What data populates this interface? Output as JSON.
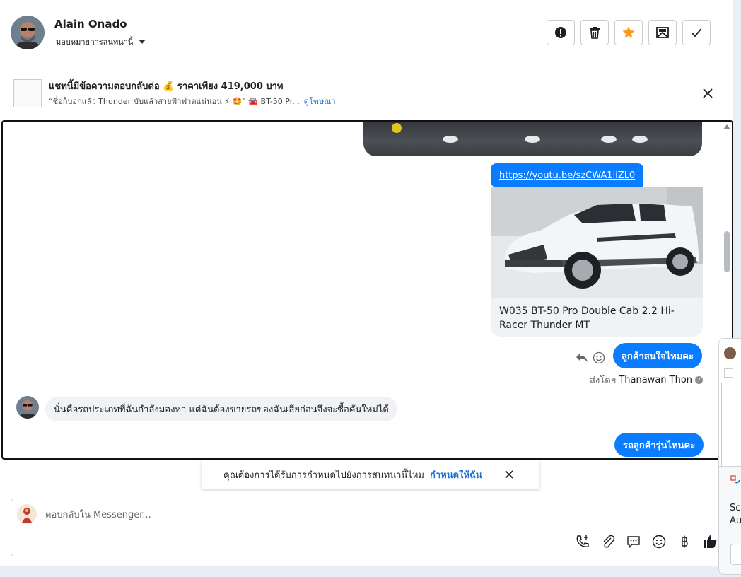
{
  "header": {
    "name": "Alain Onado",
    "assign_label": "มอบหมายการสนทนานี้"
  },
  "ad_banner": {
    "title": "แชทนี้มีข้อความตอบกลับต่อ 💰 ราคาเพียง 419,000 บาท",
    "subtitle": "“ชื่อก็บอกแล้ว Thunder ขับแล้วสายฟ้าฟาดแน่นอน ⚡ 🤩” 🚘 BT-50 Pr...",
    "link": "ดูโฆษณา"
  },
  "chat": {
    "link_message": "https://youtu.be/szCWA1liZL0",
    "card_title": "W035 BT-50 Pro Double Cab 2.2 Hi-Racer Thunder MT",
    "msg_interest": "ลูกค้าสนใจไหมคะ",
    "sent_by_prefix": "ส่งโดย",
    "sent_by_name": "Thanawan Thon",
    "incoming_message": "นั่นคือรถประเภทที่ฉันกำลังมองหา แต่ฉันต้องขายรถของฉันเสียก่อนจึงจะซื้อคันใหม่ได้",
    "msg_model": "รถลูกค้ารุ่นไหนคะ"
  },
  "reminder": {
    "text": "คุณต้องการได้รับการกำหนดไปยังการสนทนานี้ไหม",
    "link": "กำหนดให้ฉัน"
  },
  "composer": {
    "placeholder": "ตอบกลับใน Messenger..."
  },
  "popup": {
    "line1": "Scr",
    "line2": "Au"
  },
  "colors": {
    "accent": "#0a7cff",
    "link": "#1f6fd6",
    "star": "#f79a1f"
  }
}
